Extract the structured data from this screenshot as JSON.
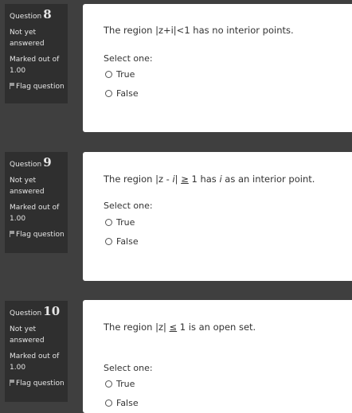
{
  "questions": [
    {
      "label": "Question",
      "number": "8",
      "state": "Not yet answered",
      "grade": "Marked out of 1.00",
      "flag": "Flag question",
      "text": "The region |z+i|<1 has no interior points.",
      "prompt": "Select one:",
      "options": [
        "True",
        "False"
      ]
    },
    {
      "label": "Question",
      "number": "9",
      "state": "Not yet answered",
      "grade": "Marked out of 1.00",
      "flag": "Flag question",
      "text_parts": [
        "The region |z - ",
        "i",
        "| ",
        "≥",
        " 1 has ",
        "i",
        " as an interior point."
      ],
      "prompt": "Select one:",
      "options": [
        "True",
        "False"
      ]
    },
    {
      "label": "Question",
      "number": "10",
      "state": "Not yet answered",
      "grade": "Marked out of 1.00",
      "flag": "Flag question",
      "text_parts": [
        "The region  |z| ",
        "≤",
        " 1 is an open set."
      ],
      "prompt": "Select one:",
      "options": [
        "True",
        "False"
      ]
    }
  ]
}
